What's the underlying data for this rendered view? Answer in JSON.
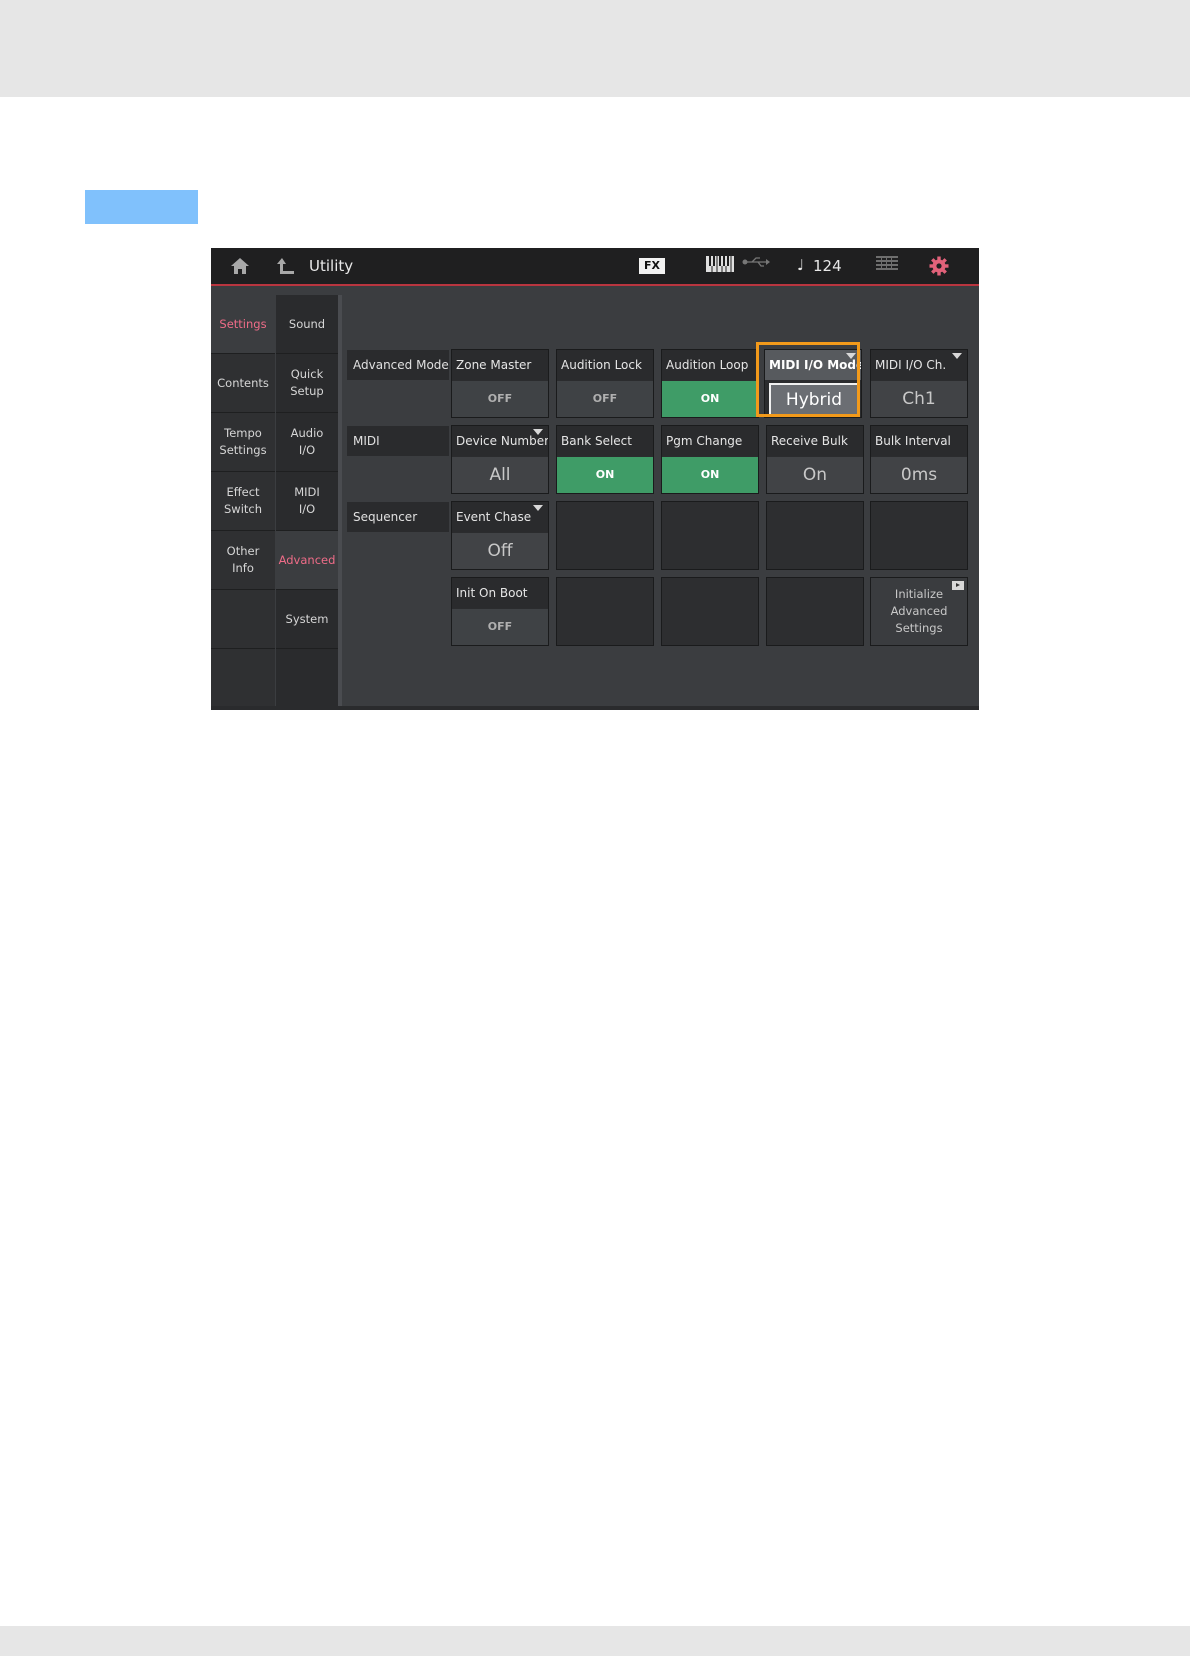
{
  "header": {
    "title": "Utility",
    "fx_label": "FX",
    "tempo_icon": "♩",
    "tempo": "124",
    "icons": [
      "home-icon",
      "back-icon",
      "fx-icon",
      "keyboard-icon",
      "usb-icon",
      "grid-icon",
      "gear-icon"
    ],
    "accent_color": "#b9353f"
  },
  "sidebar_primary": [
    {
      "label": "Settings",
      "active": true
    },
    {
      "label": "Contents"
    },
    {
      "label": "Tempo\nSettings"
    },
    {
      "label": "Effect\nSwitch"
    },
    {
      "label": "Other\nInfo"
    }
  ],
  "sidebar_secondary": [
    {
      "label": "Sound"
    },
    {
      "label": "Quick\nSetup"
    },
    {
      "label": "Audio\nI/O"
    },
    {
      "label": "MIDI\nI/O"
    },
    {
      "label": "Advanced",
      "active": true
    },
    {
      "label": "System"
    }
  ],
  "sections": {
    "advanced_mode": "Advanced Mode",
    "midi": "MIDI",
    "sequencer": "Sequencer"
  },
  "params": {
    "zone_master": {
      "label": "Zone Master",
      "value": "OFF"
    },
    "audition_lock": {
      "label": "Audition Lock",
      "value": "OFF"
    },
    "audition_loop": {
      "label": "Audition Loop",
      "value": "ON"
    },
    "midi_io_mode": {
      "label": "MIDI I/O Mode",
      "value": "Hybrid"
    },
    "midi_io_ch": {
      "label": "MIDI I/O Ch.",
      "value": "Ch1"
    },
    "device_number": {
      "label": "Device Number",
      "value": "All"
    },
    "bank_select": {
      "label": "Bank Select",
      "value": "ON"
    },
    "pgm_change": {
      "label": "Pgm Change",
      "value": "ON"
    },
    "receive_bulk": {
      "label": "Receive Bulk",
      "value": "On"
    },
    "bulk_interval": {
      "label": "Bulk Interval",
      "value": "0ms"
    },
    "event_chase": {
      "label": "Event Chase",
      "value": "Off"
    },
    "init_on_boot": {
      "label": "Init On Boot",
      "value": "OFF"
    }
  },
  "init_advanced": "Initialize\nAdvanced\nSettings",
  "colors": {
    "on_green": "#3f9c67",
    "active_pink": "#ef6c88",
    "highlight_orange": "#f29a1b",
    "step_tag_blue": "#80c1fc"
  }
}
